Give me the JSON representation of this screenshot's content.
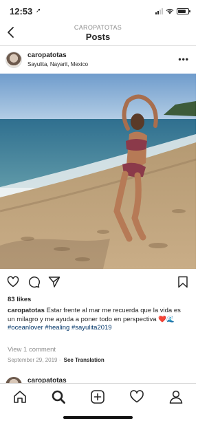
{
  "status": {
    "time": "12:53",
    "location_arrow": "➚"
  },
  "nav": {
    "username": "CAROPATOTAS",
    "title": "Posts"
  },
  "post": {
    "username": "caropatotas",
    "location": "Sayulita, Nayarit, Mexico",
    "more": "•••",
    "likes": "83 likes",
    "caption_user": "caropatotas",
    "caption_text": " Estar frente al mar me recuerda que la vida es un milagro y me ayuda a poner todo en perspectiva ",
    "caption_emoji": "❤️🌊",
    "hashtags": "#oceanlover #healing #sayulita2019",
    "comments": "View 1 comment",
    "date": "September 29, 2019",
    "see_translation": "See Translation"
  },
  "next_post": {
    "username": "caropatotas"
  },
  "icons": {
    "back": "chevron-left-icon",
    "like": "heart-icon",
    "comment": "comment-icon",
    "share": "paper-plane-icon",
    "save": "bookmark-icon",
    "home": "home-icon",
    "search": "search-icon",
    "add": "add-post-icon",
    "activity": "heart-icon",
    "profile": "profile-icon"
  },
  "colors": {
    "hashtag": "#003569",
    "muted": "#8e8e8e",
    "heart": "#e0245e"
  }
}
